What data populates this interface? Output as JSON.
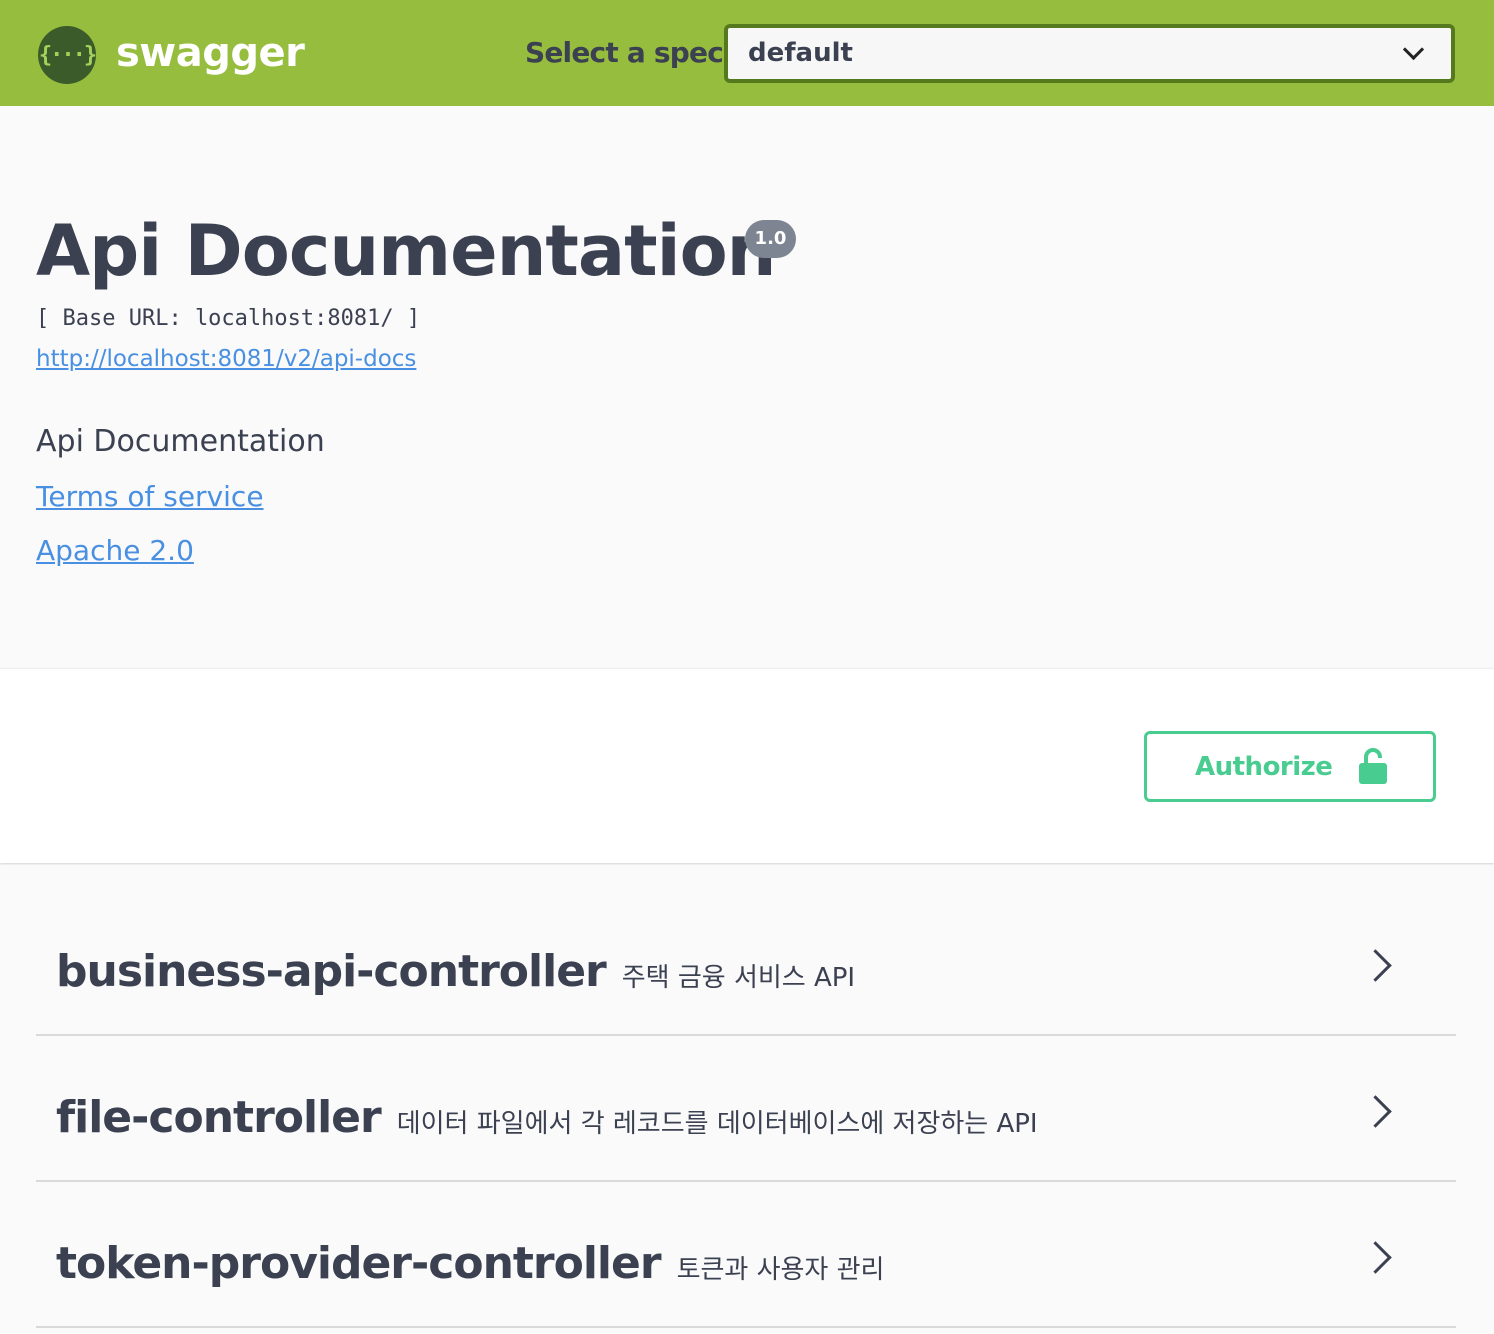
{
  "topbar": {
    "logo_glyph": "{···}",
    "logo_text": "swagger",
    "spec_label": "Select a spec",
    "spec_selected": "default",
    "brand_color": "#96bd3d"
  },
  "info": {
    "title": "Api Documentation",
    "version": "1.0",
    "base_url": "[ Base URL: localhost:8081/ ]",
    "docs_link": "http://localhost:8081/v2/api-docs",
    "description": "Api Documentation",
    "terms_of_service": "Terms of service",
    "license": "Apache 2.0"
  },
  "auth": {
    "authorize_label": "Authorize",
    "accent": "#49cc90"
  },
  "tags": [
    {
      "name": "business-api-controller",
      "description": "주택 금융 서비스 API"
    },
    {
      "name": "file-controller",
      "description": "데이터 파일에서 각 레코드를 데이터베이스에 저장하는 API"
    },
    {
      "name": "token-provider-controller",
      "description": "토큰과 사용자 관리"
    }
  ]
}
